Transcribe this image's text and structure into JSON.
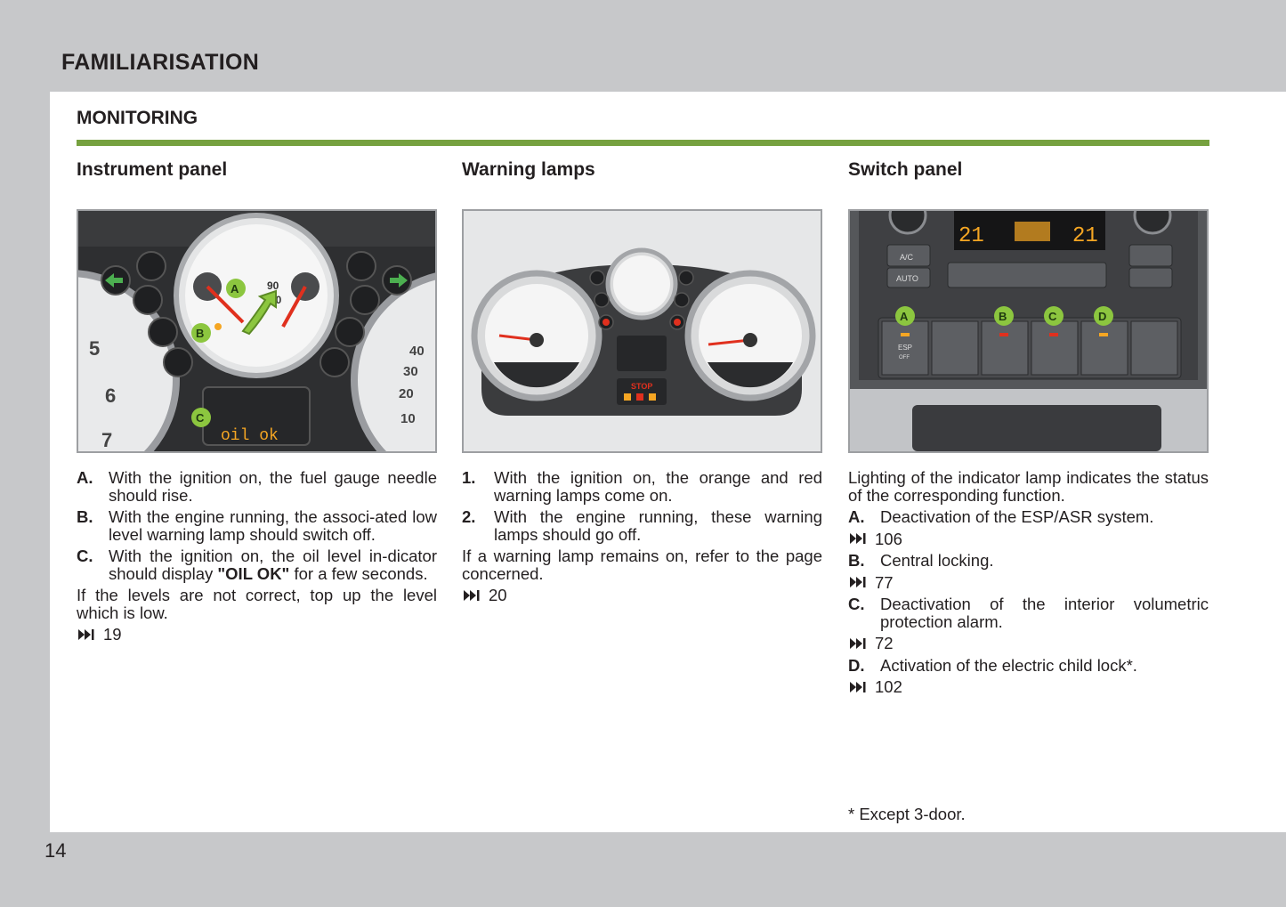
{
  "header": {
    "title": "FAMILIARISATION"
  },
  "page": {
    "number": "14"
  },
  "section": {
    "title": "MONITORING"
  },
  "columns": {
    "instrument": {
      "title": "Instrument panel",
      "figure": {
        "label_a": "A",
        "label_b": "B",
        "label_c": "C",
        "display_text": "oil ok",
        "gauge_90": "90",
        "gauge_70": "70",
        "dial_5": "5",
        "dial_6": "6",
        "dial_7": "7",
        "dial_40": "40",
        "dial_30": "30",
        "dial_20": "20",
        "dial_10": "10"
      },
      "items": [
        {
          "label": "A.",
          "text": "With the ignition on, the fuel gauge needle should rise."
        },
        {
          "label": "B.",
          "text": "With the engine running, the associ-ated low level warning lamp should switch off."
        },
        {
          "label": "C.",
          "text_before": "With the ignition on, the oil level in-dicator should display ",
          "text_bold": "\"OIL OK\"",
          "text_after": " for a few seconds."
        }
      ],
      "note": "If the levels are not correct, top up the level which is low.",
      "ref": "19"
    },
    "warning": {
      "title": "Warning lamps",
      "figure": {
        "stop_text": "STOP"
      },
      "items": [
        {
          "label": "1.",
          "text": "With the ignition on, the orange and red warning lamps come on."
        },
        {
          "label": "2.",
          "text": "With the engine running, these warning lamps should go off."
        }
      ],
      "note": "If a warning lamp remains on, refer to the page concerned.",
      "ref": "20"
    },
    "switch": {
      "title": "Switch panel",
      "figure": {
        "label_a": "A",
        "label_b": "B",
        "label_c": "C",
        "label_d": "D",
        "ac": "A/C",
        "auto": "AUTO",
        "esp": "ESP",
        "off": "OFF",
        "temp_left": "21",
        "temp_right": "21"
      },
      "intro": "Lighting of the indicator lamp indicates the status of the corresponding function.",
      "items": [
        {
          "label": "A.",
          "text": "Deactivation of the ESP/ASR system.",
          "ref": "106"
        },
        {
          "label": "B.",
          "text": "Central locking.",
          "ref": "77"
        },
        {
          "label": "C.",
          "text": "Deactivation of the interior volumetric protection alarm.",
          "ref": "72"
        },
        {
          "label": "D.",
          "text": "Activation of the electric child lock*.",
          "ref": "102"
        }
      ],
      "footnote": "* Except 3-door."
    }
  },
  "colors": {
    "accent": "#76a13f",
    "label_green": "#8cc63f",
    "amber": "#f5a623",
    "warning_red": "#e0301e"
  },
  "icons": {
    "reference": "fast-forward-end-icon"
  }
}
